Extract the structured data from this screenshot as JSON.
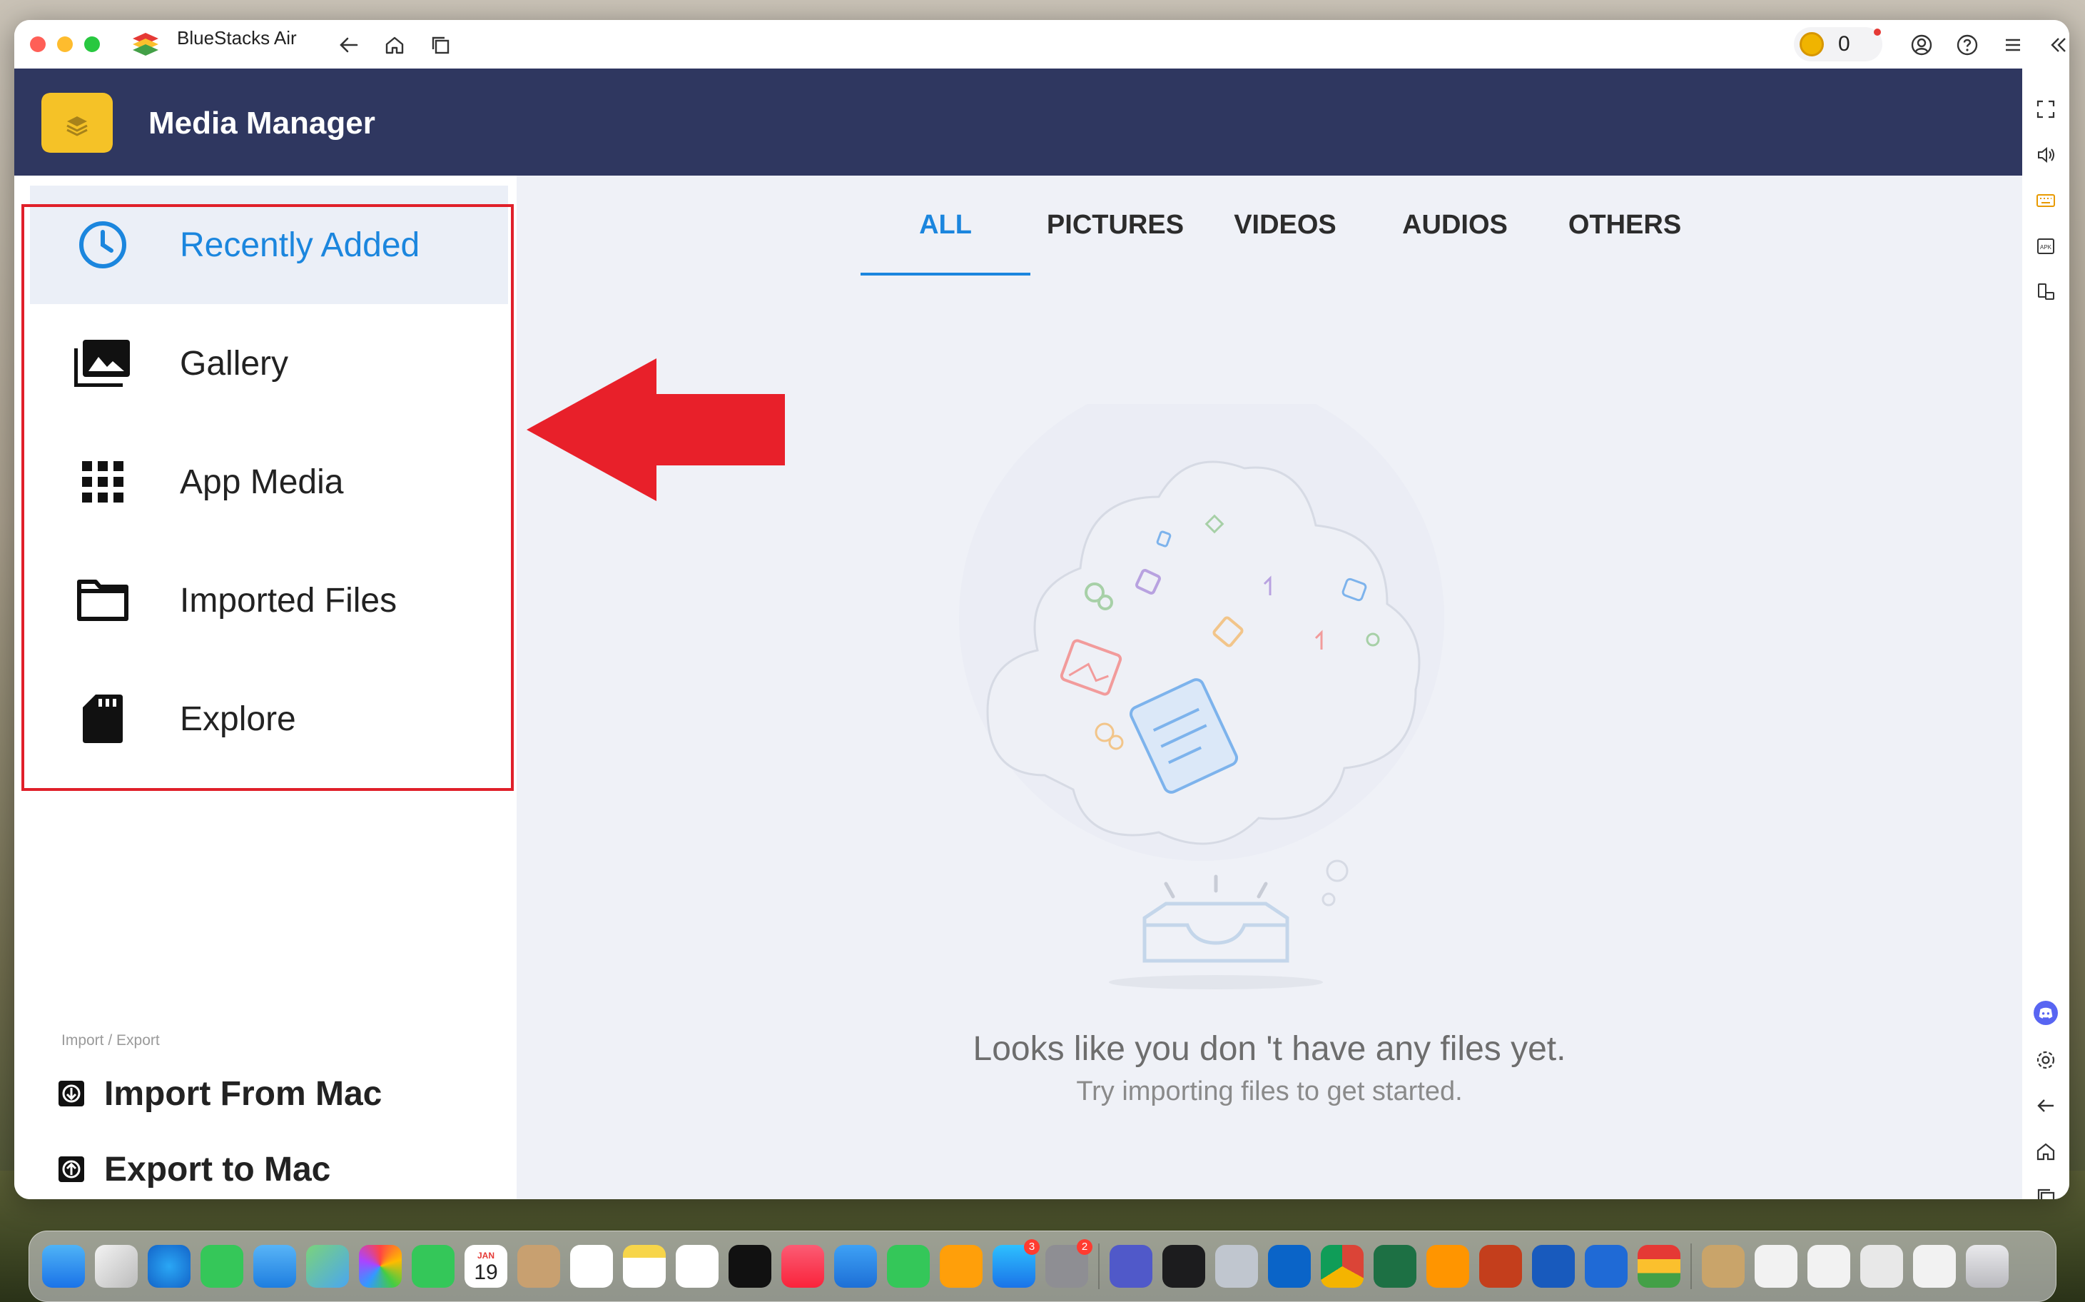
{
  "window": {
    "app_name": "BlueStacks Air",
    "coin_count": "0"
  },
  "header": {
    "title": "Media Manager"
  },
  "sidebar": {
    "items": [
      {
        "label": "Recently Added",
        "icon": "clock-icon",
        "active": true
      },
      {
        "label": "Gallery",
        "icon": "gallery-icon",
        "active": false
      },
      {
        "label": "App Media",
        "icon": "grid-icon",
        "active": false
      },
      {
        "label": "Imported Files",
        "icon": "folder-icon",
        "active": false
      },
      {
        "label": "Explore",
        "icon": "sd-card-icon",
        "active": false
      }
    ],
    "import_export_caption": "Import / Export",
    "import_label": "Import From Mac",
    "export_label": "Export to Mac"
  },
  "tabs": [
    {
      "label": "ALL",
      "active": true
    },
    {
      "label": "PICTURES",
      "active": false
    },
    {
      "label": "VIDEOS",
      "active": false
    },
    {
      "label": "AUDIOS",
      "active": false
    },
    {
      "label": "OTHERS",
      "active": false
    }
  ],
  "empty_state": {
    "title": "Looks like you don 't have any files yet.",
    "subtitle": "Try importing files to get started."
  },
  "dock": {
    "calendar_month": "JAN",
    "calendar_day": "19",
    "app_store_badge": "3",
    "settings_badge": "2"
  },
  "colors": {
    "header_bg": "#2f3760",
    "accent": "#1b86de",
    "highlight": "#e0202a",
    "main_bg": "#eff1f7"
  }
}
